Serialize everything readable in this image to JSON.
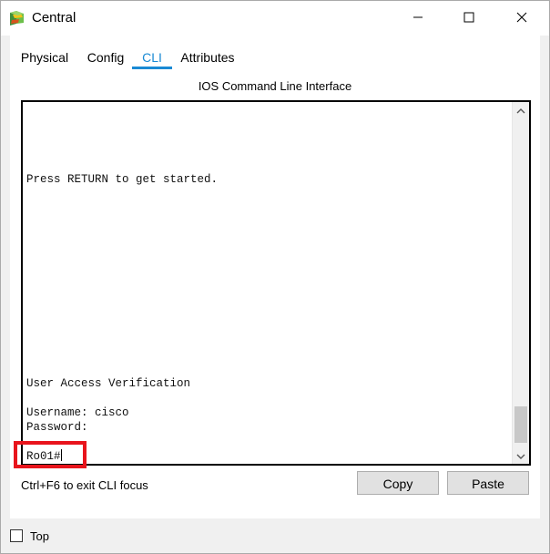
{
  "window": {
    "title": "Central",
    "icon": "packet-tracer-router-icon",
    "controls": [
      "minimize-icon",
      "maximize-icon",
      "close-icon"
    ]
  },
  "tabs": [
    {
      "label": "Physical",
      "active": false
    },
    {
      "label": "Config",
      "active": false
    },
    {
      "label": "CLI",
      "active": true
    },
    {
      "label": "Attributes",
      "active": false
    }
  ],
  "panel": {
    "title": "IOS Command Line Interface"
  },
  "terminal": {
    "line_press_return": "Press RETURN to get started.",
    "line_verification": "User Access Verification",
    "line_username": "Username: cisco",
    "line_password": "Password:",
    "line_prompt": "Ro01#"
  },
  "controls": {
    "hint": "Ctrl+F6 to exit CLI focus",
    "copy_label": "Copy",
    "paste_label": "Paste"
  },
  "footer": {
    "top_label": "Top",
    "top_checked": false
  },
  "colors": {
    "accent": "#1a8ad4",
    "highlight": "#e8141c"
  }
}
